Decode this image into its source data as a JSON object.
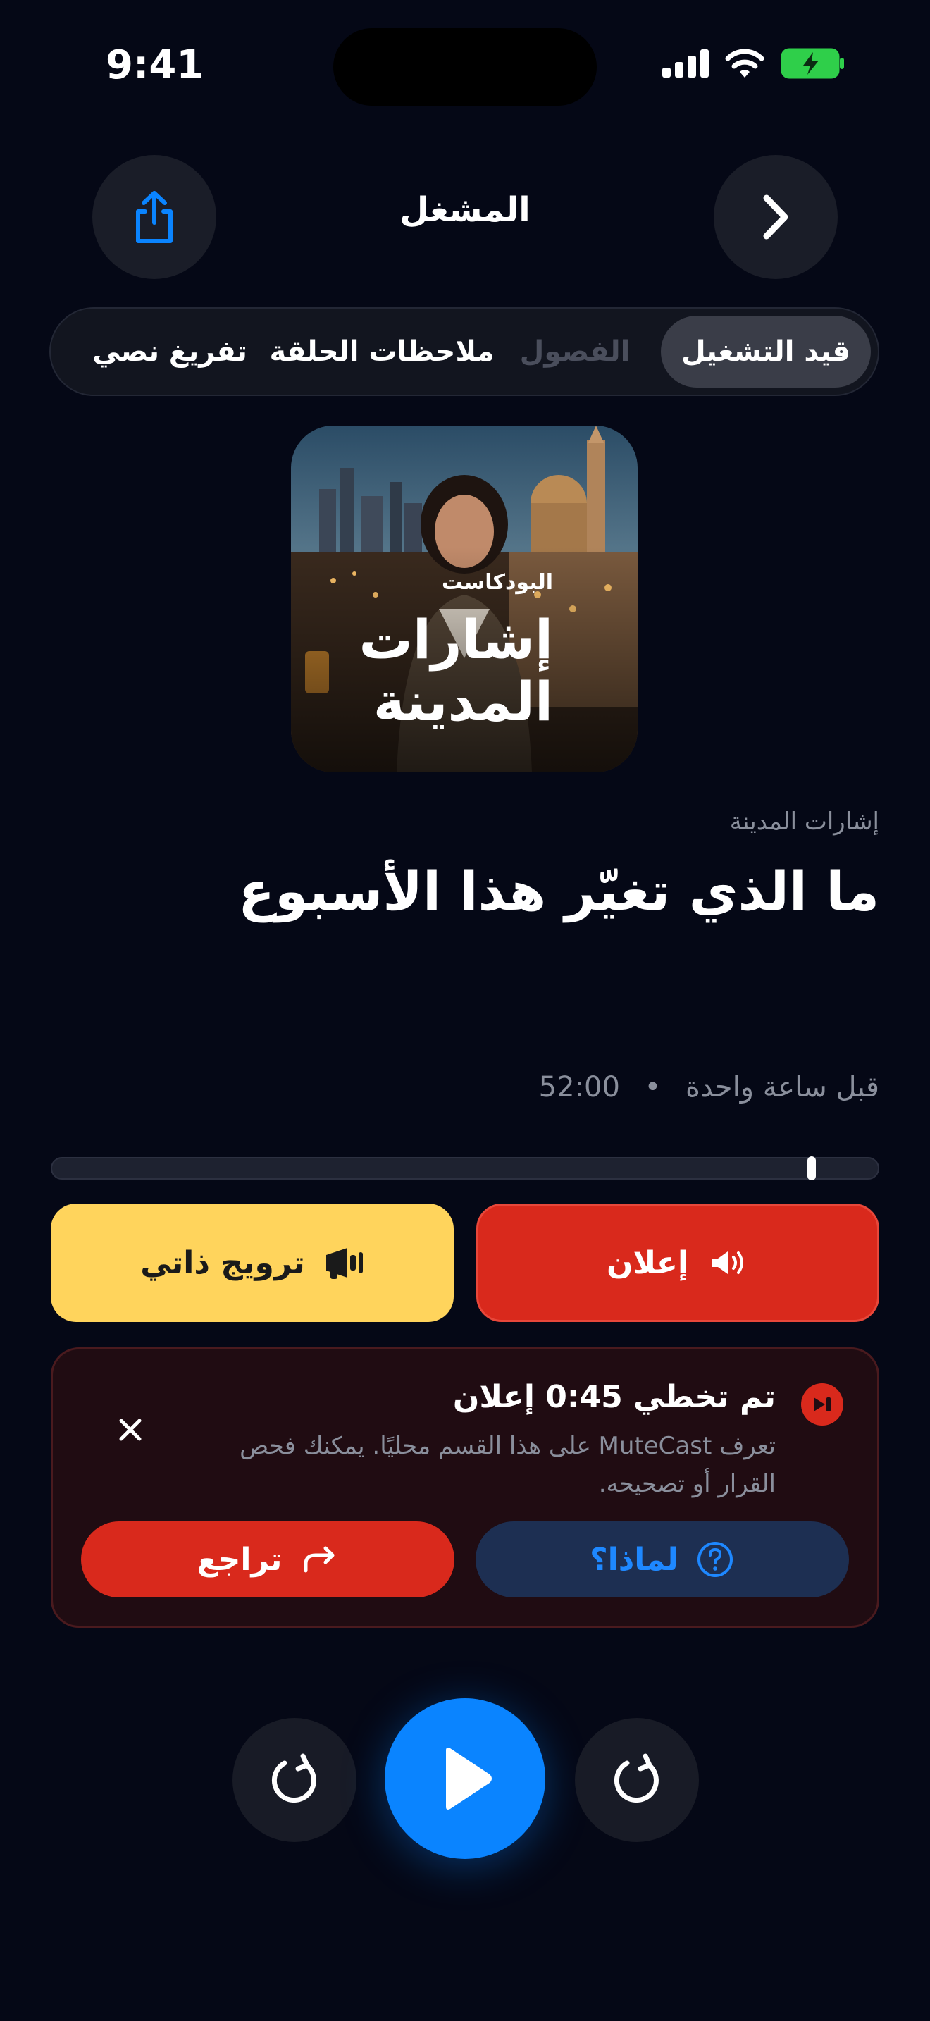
{
  "status_bar": {
    "time": "9:41"
  },
  "header": {
    "title": "المشغل"
  },
  "tabs": [
    {
      "label": "قيد التشغيل",
      "state": "active"
    },
    {
      "label": "الفصول",
      "state": "disabled"
    },
    {
      "label": "ملاحظات الحلقة",
      "state": "normal"
    },
    {
      "label": "تفريغ نصي",
      "state": "normal"
    }
  ],
  "artwork": {
    "label": "البودكاست",
    "title": "إشارات المدينة"
  },
  "episode": {
    "show_name": "إشارات المدينة",
    "title": "ما الذي تغيّر هذا الأسبوع",
    "published": "قبل ساعة واحدة",
    "separator": "•",
    "duration": "52:00"
  },
  "progress": {
    "position_fraction": 0.08
  },
  "segments": {
    "ad_label": "إعلان",
    "promo_label": "ترويج ذاتي",
    "ad_color": "#d9291c",
    "promo_color": "#ffd45c"
  },
  "skip_card": {
    "title": "تم تخطي 0:45 إعلان",
    "description": "تعرف MuteCast على هذا القسم محليًا. يمكنك فحص القرار أو تصحيحه.",
    "why_label": "لماذا؟",
    "undo_label": "تراجع"
  },
  "colors": {
    "accent": "#0a84ff",
    "background": "#050816",
    "danger": "#d9291c"
  }
}
